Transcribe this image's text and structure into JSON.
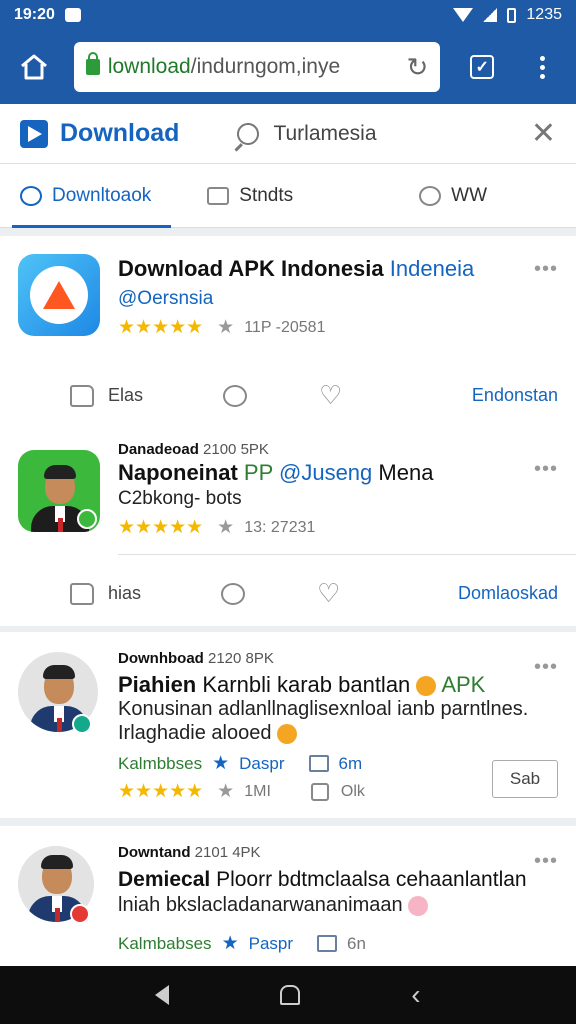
{
  "status_bar": {
    "time": "19:20",
    "right_text": "1235"
  },
  "url_bar": {
    "url_highlight": "lownload",
    "url_rest": "/indurngom,inye"
  },
  "header": {
    "brand": "Download",
    "search_text": "Turlamesia"
  },
  "tabs": [
    {
      "label": "Downltoaok",
      "icon": "search-icon"
    },
    {
      "label": "Stndts",
      "icon": "chat-icon"
    },
    {
      "label": "WW",
      "icon": "search-icon"
    }
  ],
  "cards": [
    {
      "title_bold": "Download APK Indonesia",
      "title_blue": "Indeneia",
      "handle": "@Oersnsia",
      "stars": "★★★★★",
      "stats": "11P -20581",
      "like_label": "Elas",
      "action_link": "Endonstan"
    },
    {
      "meta_name": "Danadeoad",
      "meta_stat": "2100 5PK",
      "title_bold": "Naponeinat",
      "title_green": "PP",
      "title_blue": "@Juseng",
      "title_rest": "Mena",
      "subline": "C2bkong- bots",
      "stars": "★★★★★",
      "stats": "13: 27231",
      "like_label": "hias",
      "action_link": "Domlaoskad"
    },
    {
      "meta_name": "Downhboad",
      "meta_stat": "2120 8PK",
      "title_bold": "Piahien",
      "title_rest": "Karnbli karab bantlan",
      "title_green": "APK",
      "line2": "Konusinan adlanllnaglisexnloal ianb parntlnes.",
      "line3": "Irlaghadie alooed",
      "green_label": "Kalmbbses",
      "green_label2": "Daspr",
      "green_count": "6m",
      "stars": "★★★★★",
      "stats": "1MI",
      "comments": "Olk",
      "button": "Sab"
    },
    {
      "meta_name": "Downtand",
      "meta_stat": "2101 4PK",
      "title_bold": "Demiecal",
      "title_rest": "Ploorr bdtmclaalsa cehaanlantlan",
      "line2": "lniah bkslacladanarwananimaan",
      "green_label": "Kalmbabses",
      "green_label2": "Paspr",
      "green_count": "6n"
    }
  ],
  "colors": {
    "bar_blue": "#1e5aa6",
    "link_blue": "#1565c0",
    "green": "#2e7d32",
    "star": "#f5b800"
  }
}
